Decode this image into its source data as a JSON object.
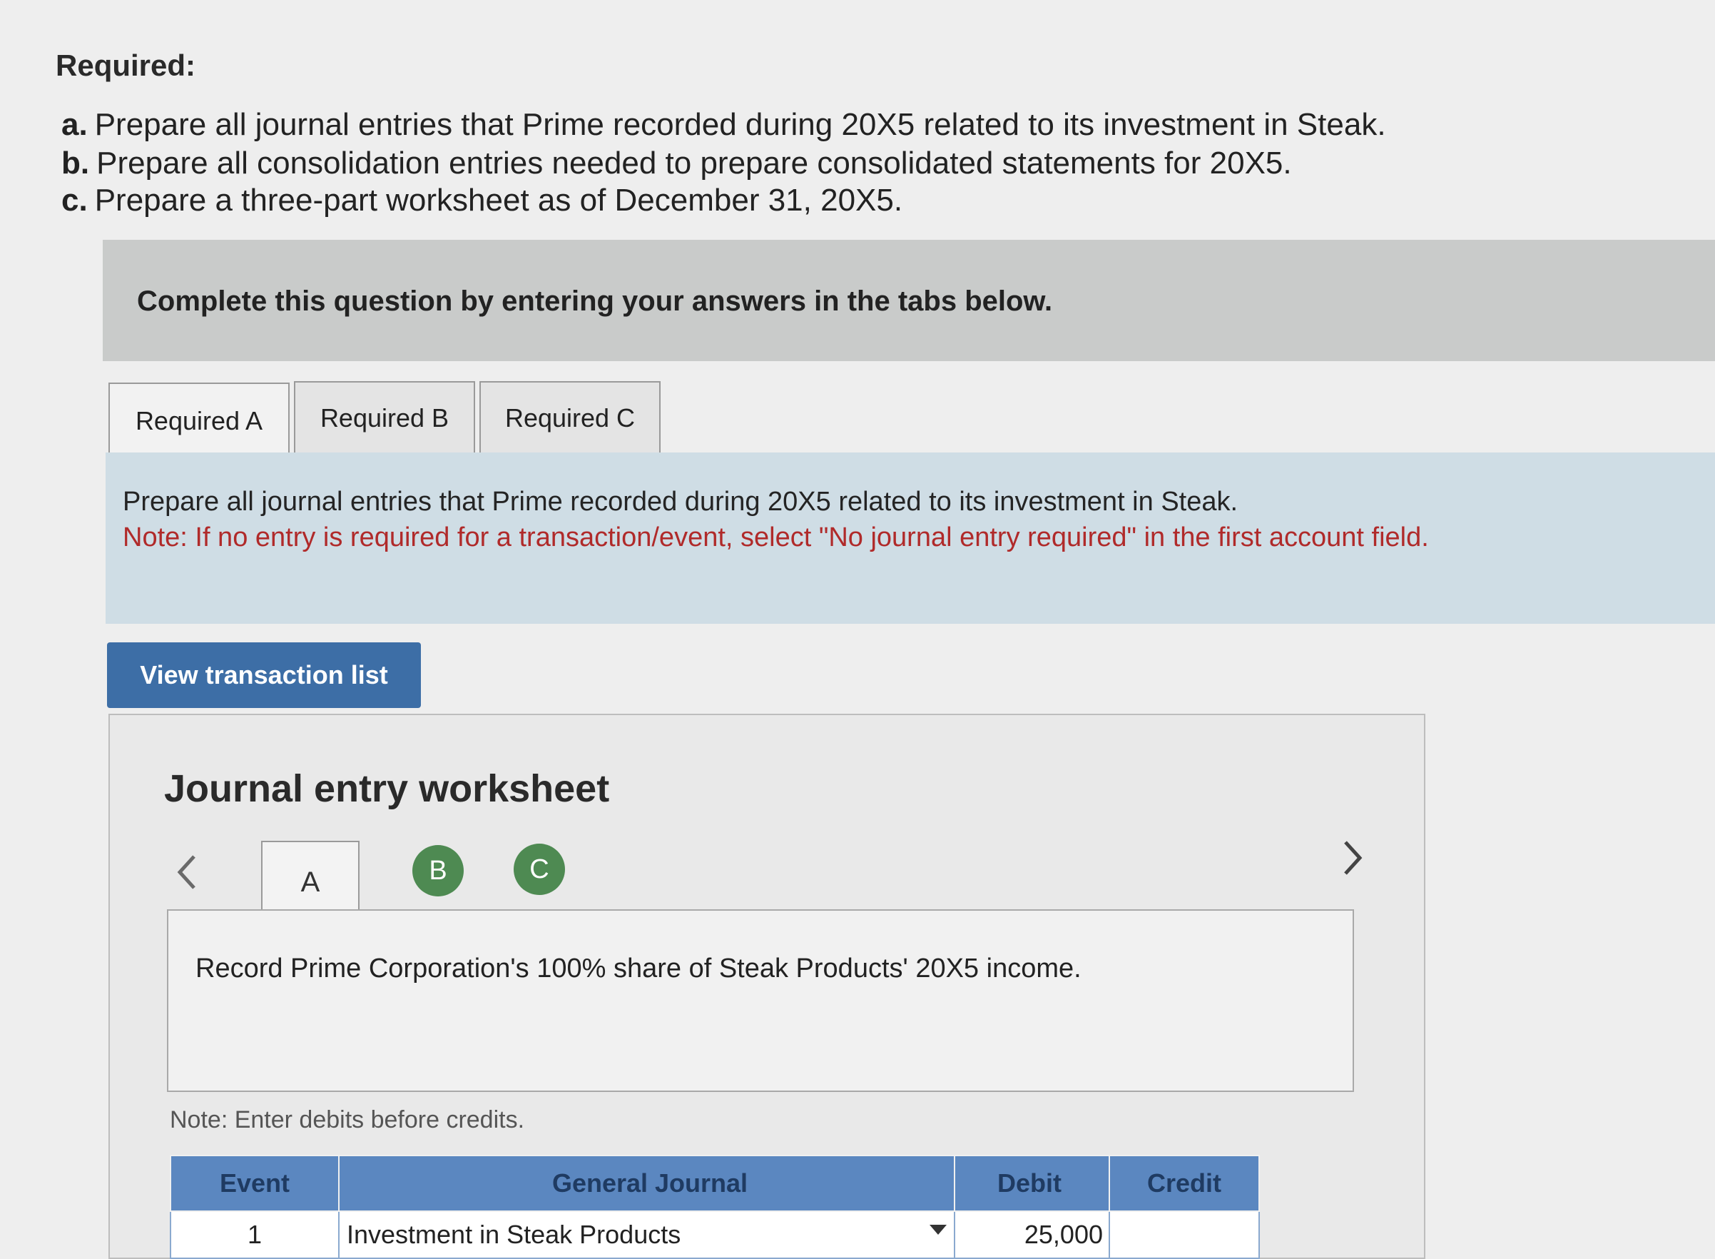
{
  "required": {
    "heading": "Required:",
    "items": [
      {
        "letter": "a.",
        "text": "Prepare all journal entries that Prime recorded during 20X5 related to its investment in Steak."
      },
      {
        "letter": "b.",
        "text": "Prepare all consolidation entries needed to prepare consolidated statements for 20X5."
      },
      {
        "letter": "c.",
        "text": "Prepare a three-part worksheet as of December 31, 20X5."
      }
    ]
  },
  "banner": {
    "text": "Complete this question by entering your answers in the tabs below."
  },
  "tabs": [
    {
      "label": "Required A",
      "active": true
    },
    {
      "label": "Required B",
      "active": false
    },
    {
      "label": "Required C",
      "active": false
    }
  ],
  "req_panel": {
    "instruction": "Prepare all journal entries that Prime recorded during 20X5 related to its investment in Steak.",
    "note": "Note: If no entry is required for a transaction/event, select \"No journal entry required\" in the first account field."
  },
  "view_button": {
    "label": "View transaction list"
  },
  "worksheet": {
    "title": "Journal entry worksheet",
    "prev_icon": "chevron-left-icon",
    "next_icon": "chevron-right-icon",
    "steps": [
      "A",
      "B",
      "C"
    ],
    "active_step": "A",
    "event_description": "Record Prime Corporation's 100% share of Steak Products' 20X5 income.",
    "debit_note": "Note: Enter debits before credits.",
    "table": {
      "headers": {
        "event": "Event",
        "account": "General Journal",
        "debit": "Debit",
        "credit": "Credit"
      },
      "rows": [
        {
          "event": "1",
          "account": "Investment in Steak Products",
          "debit": "25,000",
          "credit": ""
        }
      ]
    }
  },
  "colors": {
    "button": "#3d6ea6",
    "step_circle": "#4e8a52",
    "table_header": "#5b87c0",
    "note_red": "#b02a2a"
  }
}
